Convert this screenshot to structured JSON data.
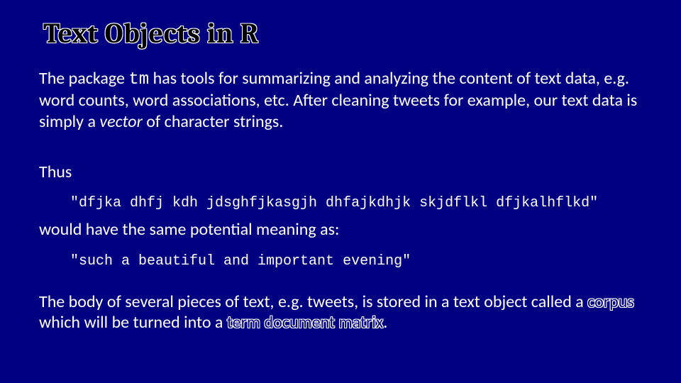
{
  "title": "Text Objects in R",
  "para1_pre": "The package ",
  "para1_tm": "tm",
  "para1_mid": " has tools for summarizing and analyzing the content of text data, e.g. word counts, word associations, etc.  After cleaning tweets for example, our text data is simply a ",
  "para1_vector": "vector",
  "para1_post": " of character strings.",
  "thus": "Thus",
  "code1": "\"dfjka dhfj kdh jdsghfjkasgjh dhfajkdhjk skjdflkl dfjkalhflkd\"",
  "would": "would have the same potential meaning as:",
  "code2": "\"such a beautiful and important evening\"",
  "para2_pre": "The body of several pieces of text, e.g. tweets, is stored in a text object called a ",
  "para2_corpus": "corpus",
  "para2_mid": " which will be turned into a ",
  "para2_tdm": "term document matrix",
  "para2_post": "."
}
